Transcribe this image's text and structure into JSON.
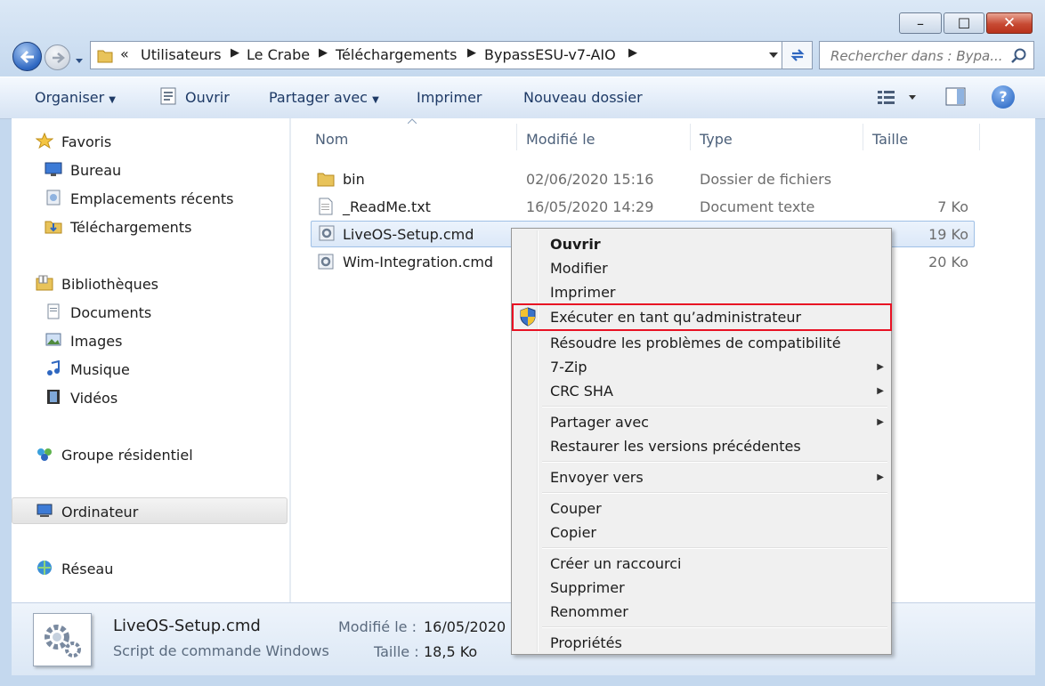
{
  "window": {
    "buttons": {
      "minimize": "–",
      "maximize": "☐",
      "close": "✕"
    }
  },
  "address": {
    "overflow": "«",
    "crumbs": [
      "Utilisateurs",
      "Le Crabe",
      "Téléchargements",
      "BypassESU-v7-AIO"
    ]
  },
  "search": {
    "placeholder": "Rechercher dans : Bypa..."
  },
  "toolbar": {
    "organize": "Organiser",
    "open": "Ouvrir",
    "share": "Partager avec",
    "print": "Imprimer",
    "new_folder": "Nouveau dossier",
    "help": "?"
  },
  "nav": {
    "favorites": "Favoris",
    "desktop": "Bureau",
    "recent": "Emplacements récents",
    "downloads": "Téléchargements",
    "libraries": "Bibliothèques",
    "documents": "Documents",
    "images": "Images",
    "music": "Musique",
    "videos": "Vidéos",
    "homegroup": "Groupe résidentiel",
    "computer": "Ordinateur",
    "network": "Réseau"
  },
  "columns": {
    "name": "Nom",
    "modified": "Modifié le",
    "type": "Type",
    "size": "Taille"
  },
  "files": [
    {
      "name": "bin",
      "modified": "02/06/2020 15:16",
      "type": "Dossier de fichiers",
      "size": ""
    },
    {
      "name": "_ReadMe.txt",
      "modified": "16/05/2020 14:29",
      "type": "Document texte",
      "size": "7 Ko"
    },
    {
      "name": "LiveOS-Setup.cmd",
      "modified": "",
      "type": "",
      "size": "19 Ko"
    },
    {
      "name": "Wim-Integration.cmd",
      "modified": "",
      "type": "",
      "size": "20 Ko"
    }
  ],
  "context_menu": {
    "open": "Ouvrir",
    "edit": "Modifier",
    "print": "Imprimer",
    "run_as_admin": "Exécuter en tant qu’administrateur",
    "troubleshoot": "Résoudre les problèmes de compatibilité",
    "zip": "7-Zip",
    "crc": "CRC SHA",
    "share": "Partager avec",
    "restore": "Restaurer les versions précédentes",
    "send_to": "Envoyer vers",
    "cut": "Couper",
    "copy": "Copier",
    "shortcut": "Créer un raccourci",
    "delete": "Supprimer",
    "rename": "Renommer",
    "properties": "Propriétés",
    "highlight_color": "#e81123"
  },
  "details": {
    "filename": "LiveOS-Setup.cmd",
    "filetype": "Script de commande Windows",
    "modified_label": "Modifié le :",
    "modified_value": "16/05/2020",
    "size_label": "Taille :",
    "size_value": "18,5 Ko"
  }
}
